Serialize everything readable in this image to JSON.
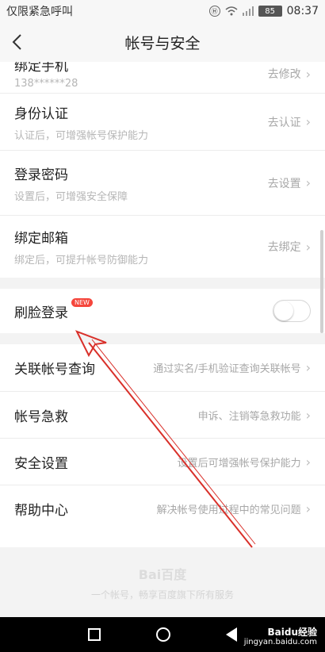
{
  "status": {
    "carrier": "仅限紧急呼叫",
    "battery": "85",
    "time": "08:37",
    "signal": "Ⓗ"
  },
  "header": {
    "title": "帐号与安全"
  },
  "rows": [
    {
      "title": "绑定手机",
      "sub": "138******28",
      "action": "去修改"
    },
    {
      "title": "身份认证",
      "sub": "认证后，可增强帐号保护能力",
      "action": "去认证"
    },
    {
      "title": "登录密码",
      "sub": "设置后，可增强安全保障",
      "action": "去设置"
    },
    {
      "title": "绑定邮箱",
      "sub": "绑定后，可提升帐号防御能力",
      "action": "去绑定"
    }
  ],
  "face_login": {
    "title": "刷脸登录",
    "badge": "NEW",
    "enabled": false
  },
  "menu": [
    {
      "title": "关联帐号查询",
      "desc": "通过实名/手机验证查询关联帐号"
    },
    {
      "title": "帐号急救",
      "desc": "申诉、注销等急救功能"
    },
    {
      "title": "安全设置",
      "desc": "设置后可增强帐号保护能力"
    },
    {
      "title": "帮助中心",
      "desc": "解决帐号使用过程中的常见问题"
    }
  ],
  "footer": {
    "logo": "Bai百度",
    "text": "一个帐号，畅享百度旗下所有服务"
  },
  "watermark": {
    "line1": "Baidu经验",
    "line2": "jingyan.baidu.com"
  },
  "colors": {
    "annotation_arrow": "#d9302a",
    "badge": "#f5463c"
  }
}
